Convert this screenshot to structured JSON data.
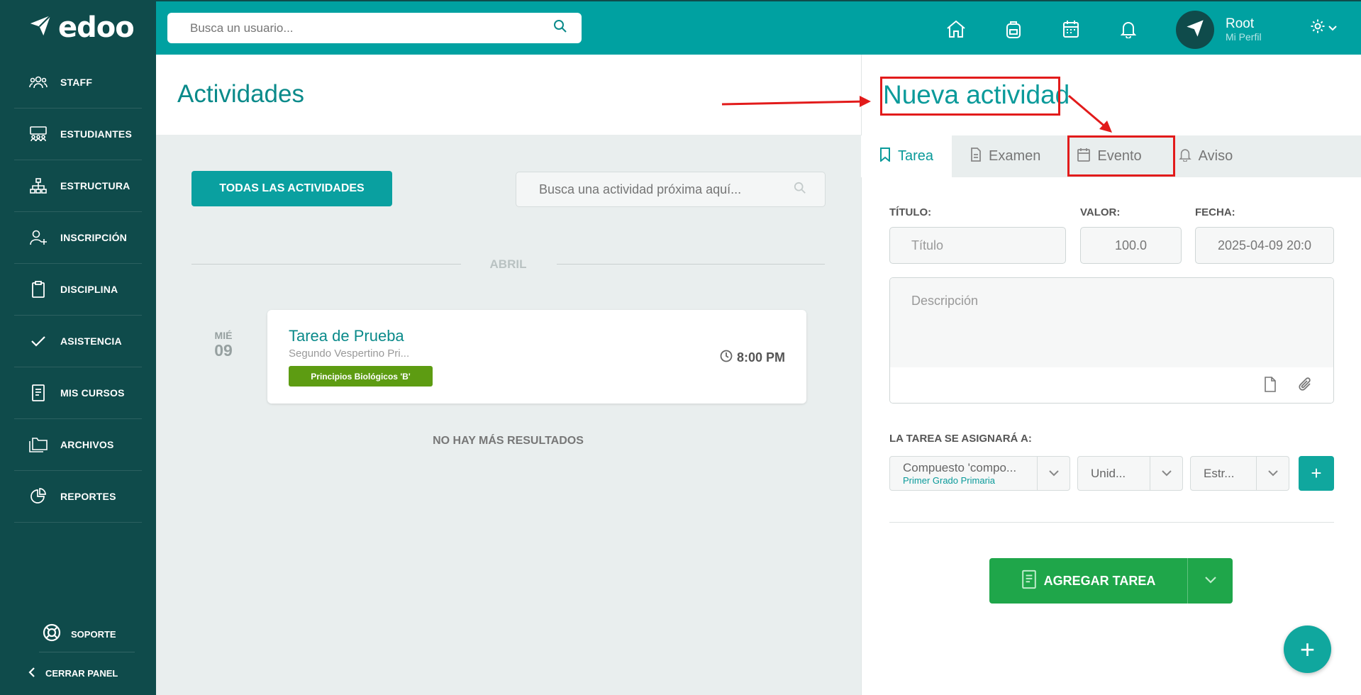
{
  "app": {
    "logo_text": "edoo"
  },
  "sidebar": {
    "items": [
      {
        "label": "STAFF",
        "icon": "staff-icon"
      },
      {
        "label": "ESTUDIANTES",
        "icon": "students-icon"
      },
      {
        "label": "ESTRUCTURA",
        "icon": "structure-icon"
      },
      {
        "label": "INSCRIPCIÓN",
        "icon": "enroll-icon"
      },
      {
        "label": "DISCIPLINA",
        "icon": "clipboard-icon"
      },
      {
        "label": "ASISTENCIA",
        "icon": "check-icon"
      },
      {
        "label": "MIS CURSOS",
        "icon": "book-icon"
      },
      {
        "label": "ARCHIVOS",
        "icon": "folders-icon"
      },
      {
        "label": "REPORTES",
        "icon": "report-icon"
      }
    ],
    "support_label": "SOPORTE",
    "close_label": "CERRAR PANEL"
  },
  "header": {
    "search_placeholder": "Busca un usuario...",
    "user_name": "Root",
    "user_sub": "Mi Perfil"
  },
  "main": {
    "title": "Actividades",
    "all_button": "TODAS LAS ACTIVIDADES",
    "search_placeholder": "Busca una actividad próxima aquí...",
    "month": "ABRIL",
    "day_week": "MIÉ",
    "day_num": "09",
    "card": {
      "title": "Tarea de Prueba",
      "subtitle": "Segundo Vespertino Pri...",
      "tag": "Principios Biológicos 'B'",
      "time": "8:00 PM"
    },
    "no_more": "NO HAY MÁS RESULTADOS"
  },
  "panel": {
    "title": "Nueva actividad",
    "tabs": [
      "Tarea",
      "Examen",
      "Evento",
      "Aviso"
    ],
    "title_label": "TÍTULO:",
    "title_placeholder": "Título",
    "value_label": "VALOR:",
    "value": "100.0",
    "date_label": "FECHA:",
    "date_value": "2025-04-09 20:0",
    "desc_placeholder": "Descripción",
    "assign_label": "LA TAREA SE ASIGNARÁ A:",
    "select1": "Compuesto 'compo...",
    "select1_sub": "Primer Grado Primaria",
    "select2": "Unid...",
    "select3": "Estr...",
    "add_button": "AGREGAR TAREA"
  },
  "colors": {
    "sidebar": "#0f4b4b",
    "accent": "#00a1a1",
    "highlight": "#e21b1b",
    "green": "#1fa64a"
  }
}
